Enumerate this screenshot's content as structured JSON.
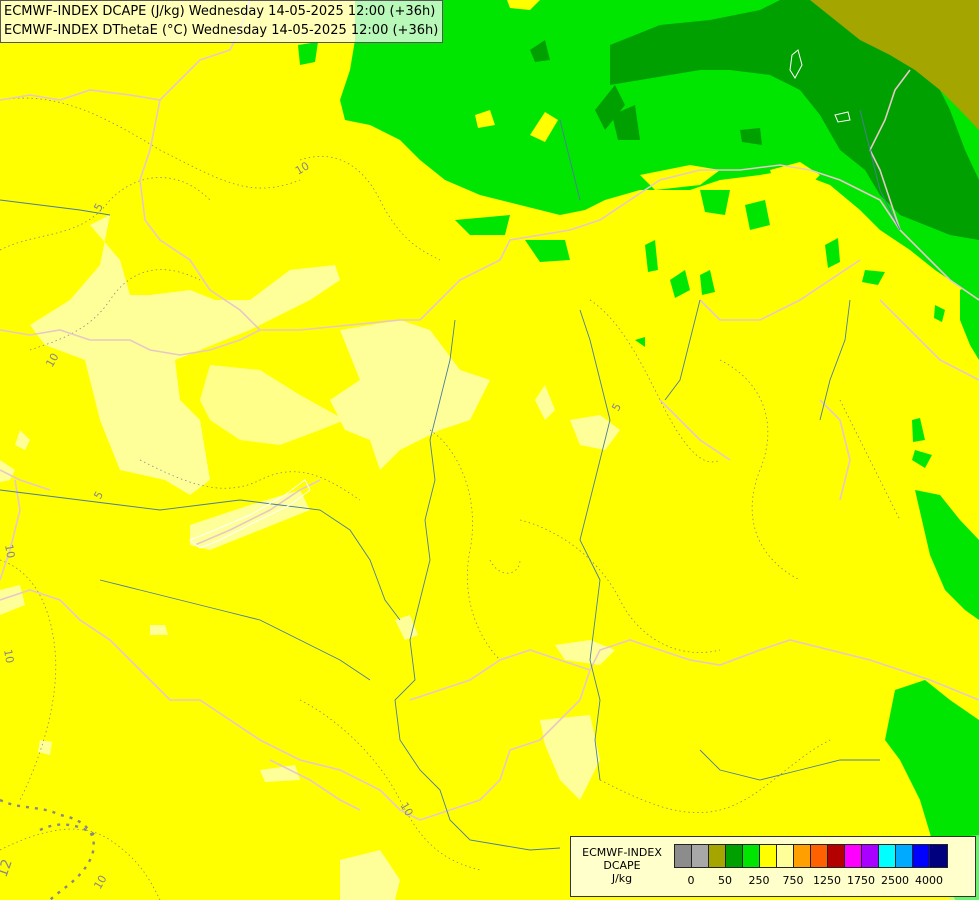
{
  "header": {
    "line1": "ECMWF-INDEX DCAPE (J/kg) Wednesday 14-05-2025 12:00 (+36h)",
    "line2": "ECMWF-INDEX DThetaE (°C) Wednesday 14-05-2025 12:00 (+36h)"
  },
  "legend": {
    "title_line1": "ECMWF-INDEX",
    "title_line2": "DCAPE",
    "unit": "J/kg",
    "colors": [
      "#8c8c8c",
      "#a8a8a8",
      "#a5a500",
      "#00a000",
      "#00e600",
      "#ffff00",
      "#ffff99",
      "#ffa000",
      "#ff6000",
      "#b40000",
      "#ff00ff",
      "#aa00ff",
      "#00ffff",
      "#00aaff",
      "#0000ff",
      "#00007f"
    ],
    "tick_labels": [
      "0",
      "50",
      "250",
      "750",
      "1250",
      "1750",
      "2500",
      "4000"
    ]
  },
  "map": {
    "fill_colors": {
      "yellow": "#ffff00",
      "light_yellow": "#ffff99",
      "green": "#00e600",
      "dark_green": "#00a000",
      "olive": "#a5a500"
    },
    "contour_labels": [
      "10",
      "5",
      "10",
      "5",
      "5",
      "10",
      "10",
      "12",
      "10",
      "10"
    ]
  }
}
